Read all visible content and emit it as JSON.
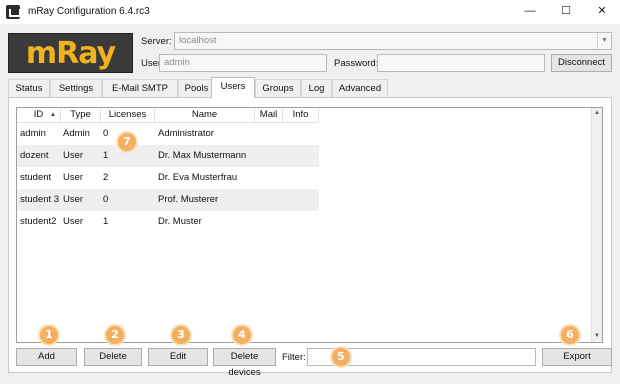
{
  "window": {
    "title": "mRay Configuration 6.4.rc3",
    "controls": {
      "minimize": "—",
      "maximize": "☐",
      "close": "✕"
    }
  },
  "logo": {
    "text": "mRay"
  },
  "connection": {
    "server_label": "Server:",
    "server_value": "localhost",
    "username_label": "Username:",
    "username_value": "admin",
    "password_label": "Password:",
    "password_value": "",
    "disconnect_label": "Disconnect"
  },
  "tabs": [
    {
      "label": "Status"
    },
    {
      "label": "Settings"
    },
    {
      "label": "E-Mail SMTP"
    },
    {
      "label": "Pools"
    },
    {
      "label": "Users",
      "active": true
    },
    {
      "label": "Groups"
    },
    {
      "label": "Log"
    },
    {
      "label": "Advanced"
    }
  ],
  "users_table": {
    "columns": [
      "ID",
      "Type",
      "Licenses",
      "Name",
      "Mail",
      "Info"
    ],
    "sort_column": "ID",
    "rows": [
      {
        "id": "admin",
        "type": "Admin",
        "licenses": "0",
        "name": "Administrator",
        "mail": "",
        "info": ""
      },
      {
        "id": "dozent",
        "type": "User",
        "licenses": "1",
        "name": "Dr. Max Mustermann",
        "mail": "",
        "info": ""
      },
      {
        "id": "student",
        "type": "User",
        "licenses": "2",
        "name": "Dr. Eva Musterfrau",
        "mail": "",
        "info": ""
      },
      {
        "id": "student 3",
        "type": "User",
        "licenses": "0",
        "name": "Prof. Musterer",
        "mail": "",
        "info": ""
      },
      {
        "id": "student2",
        "type": "User",
        "licenses": "1",
        "name": "Dr. Muster",
        "mail": "",
        "info": ""
      }
    ]
  },
  "actions": {
    "add_label": "Add",
    "delete_label": "Delete",
    "edit_label": "Edit",
    "delete_devices_label": "Delete devices",
    "filter_label": "Filter:",
    "filter_value": "",
    "export_label": "Export"
  },
  "markers": [
    "1",
    "2",
    "3",
    "4",
    "5",
    "6",
    "7"
  ],
  "colors": {
    "logo_text": "#f0b21e",
    "marker": "#f3b061",
    "row_alt": "#efefef"
  }
}
